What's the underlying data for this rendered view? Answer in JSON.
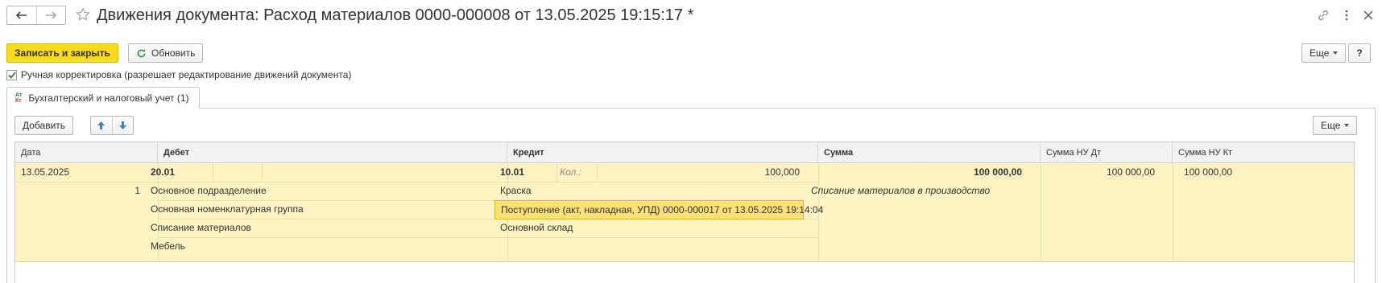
{
  "window": {
    "title": "Движения документа: Расход материалов 0000-000008 от 13.05.2025 19:15:17 *"
  },
  "toolbar": {
    "save_close_label": "Записать и закрыть",
    "refresh_label": "Обновить",
    "more_label": "Еще",
    "help_label": "?"
  },
  "manual_edit": {
    "checked": true,
    "label": "Ручная корректировка (разрешает редактирование движений документа)"
  },
  "tabs": [
    {
      "label": "Бухгалтерский и налоговый учет (1)",
      "badge_top": "Ат",
      "badge_bottom": "Кт"
    }
  ],
  "table_toolbar": {
    "add_label": "Добавить",
    "more_label": "Еще"
  },
  "table": {
    "columns": [
      "Дата",
      "Дебет",
      "Кредит",
      "Сумма",
      "Сумма НУ Дт",
      "Сумма НУ Кт"
    ],
    "row": {
      "date": "13.05.2025",
      "line_no": "1",
      "debit_account": "20.01",
      "debit_subconto": [
        "Основное подразделение",
        "Основная номенклатурная группа",
        "Списание материалов",
        "Мебель"
      ],
      "credit_account": "10.01",
      "qty_label": "Кол.:",
      "qty_value": "100,000",
      "credit_subconto": [
        "Краска",
        "Поступление (акт, накладная, УПД) 0000-000017 от 13.05.2025 19:14:04",
        "Основной склад"
      ],
      "sum": "100 000,00",
      "content": "Списание материалов в производство",
      "sum_nu_dt": "100 000,00",
      "sum_nu_kt": "100 000,00"
    }
  },
  "colors": {
    "accent": "#fada1f",
    "row_highlight": "#fdf3c3",
    "selected_cell": "#fbe07a"
  }
}
